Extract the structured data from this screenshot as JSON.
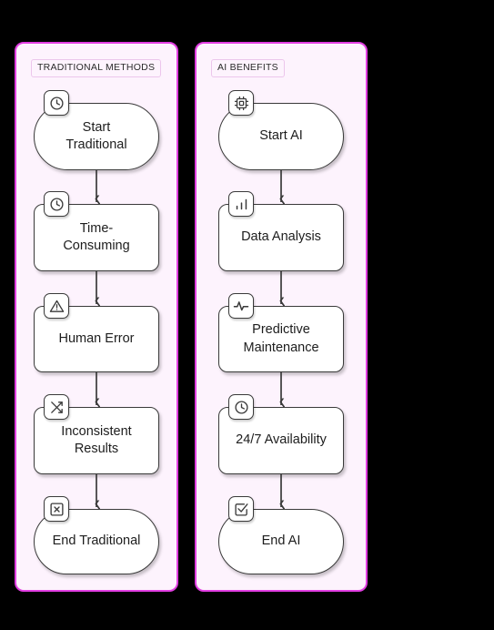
{
  "page": {
    "background_color": "#000000",
    "diagram_type": "flowchart",
    "direction": "top-down"
  },
  "panels": [
    {
      "id": "traditional",
      "label": "TRADITIONAL METHODS",
      "border_color": "#e23ee2",
      "fill_color": "#fdf3fd",
      "nodes": [
        {
          "id": "start-traditional",
          "label": "Start\nTraditional",
          "shape": "stadium",
          "icon": "clock-icon"
        },
        {
          "id": "time-consuming",
          "label": "Time-\nConsuming",
          "shape": "rounded-rect",
          "icon": "clock-icon"
        },
        {
          "id": "human-error",
          "label": "Human Error",
          "shape": "rounded-rect",
          "icon": "warning-triangle-icon"
        },
        {
          "id": "inconsistent-results",
          "label": "Inconsistent\nResults",
          "shape": "rounded-rect",
          "icon": "shuffle-icon"
        },
        {
          "id": "end-traditional",
          "label": "End Traditional",
          "shape": "stadium",
          "icon": "x-square-icon"
        }
      ],
      "edges": [
        {
          "from": "start-traditional",
          "to": "time-consuming"
        },
        {
          "from": "time-consuming",
          "to": "human-error"
        },
        {
          "from": "human-error",
          "to": "inconsistent-results"
        },
        {
          "from": "inconsistent-results",
          "to": "end-traditional"
        }
      ]
    },
    {
      "id": "ai",
      "label": "AI BENEFITS",
      "border_color": "#e23ee2",
      "fill_color": "#fdf3fd",
      "nodes": [
        {
          "id": "start-ai",
          "label": "Start AI",
          "shape": "stadium",
          "icon": "cpu-icon"
        },
        {
          "id": "data-analysis",
          "label": "Data Analysis",
          "shape": "rounded-rect",
          "icon": "bar-chart-icon"
        },
        {
          "id": "predictive-maintenance",
          "label": "Predictive\nMaintenance",
          "shape": "rounded-rect",
          "icon": "activity-pulse-icon"
        },
        {
          "id": "availability",
          "label": "24/7 Availability",
          "shape": "rounded-rect",
          "icon": "clock-icon"
        },
        {
          "id": "end-ai",
          "label": "End AI",
          "shape": "stadium",
          "icon": "check-square-icon"
        }
      ],
      "edges": [
        {
          "from": "start-ai",
          "to": "data-analysis"
        },
        {
          "from": "data-analysis",
          "to": "predictive-maintenance"
        },
        {
          "from": "predictive-maintenance",
          "to": "availability"
        },
        {
          "from": "availability",
          "to": "end-ai"
        }
      ]
    }
  ],
  "style": {
    "node_border_color": "#3a3a3a",
    "node_fill_color": "#ffffff",
    "node_text_color": "#1d1d1d",
    "edge_color": "#3a3a3a",
    "label_badge_border": "#ecc6ec"
  }
}
